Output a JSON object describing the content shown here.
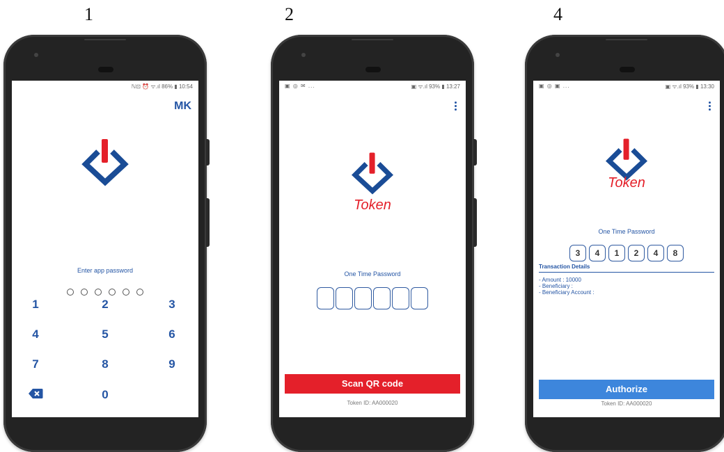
{
  "step_labels": [
    "1",
    "2",
    "4"
  ],
  "colors": {
    "brand_blue": "#1a4c96",
    "brand_red": "#e4202a",
    "scan_button": "#e4202a",
    "authorize_button": "#3d86dc"
  },
  "screen1": {
    "status_left": "",
    "status_right": "ℕ⊡ ⏰ ᯤ.ıl 86% ▮ 10:54",
    "user_initials": "MK",
    "prompt": "Enter app password",
    "keys": [
      "1",
      "2",
      "3",
      "4",
      "5",
      "6",
      "7",
      "8",
      "9",
      "0"
    ],
    "backspace_icon": "backspace-icon"
  },
  "screen2": {
    "status_left": "▣ ◎ ✉ ...",
    "status_right": "▣ ᯤ.ıl 93% ▮ 13:27",
    "brand": "Token",
    "otp_caption": "One Time Password",
    "otp_digits": [
      "",
      "",
      "",
      "",
      "",
      ""
    ],
    "button_label": "Scan QR code",
    "token_id": "Token ID: AA000020"
  },
  "screen3": {
    "status_left": "▣ ◎ ▣ ...",
    "status_right": "▣ ᯤ.ıl 93% ▮ 13:30",
    "brand": "Token",
    "otp_caption": "One Time Password",
    "otp_digits": [
      "3",
      "4",
      "1",
      "2",
      "4",
      "8"
    ],
    "tx_title": "Transaction Details",
    "tx_amount": "- Amount : 10000",
    "tx_beneficiary": "- Beneficiary :",
    "tx_account": "- Beneficiary Account :",
    "button_label": "Authorize",
    "token_id": "Token ID: AA000020"
  }
}
